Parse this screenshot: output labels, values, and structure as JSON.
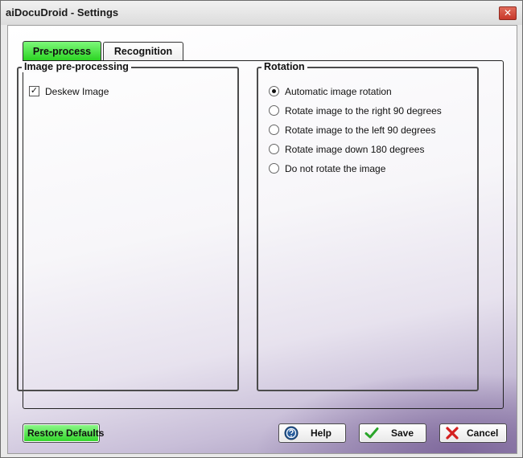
{
  "window": {
    "title": "aiDocuDroid - Settings",
    "close_symbol": "✕"
  },
  "tabs": [
    {
      "label": "Pre-process",
      "active": true
    },
    {
      "label": "Recognition",
      "active": false
    }
  ],
  "preprocessing": {
    "title": "Image pre-processing",
    "deskew": {
      "label": "Deskew Image",
      "checked": true,
      "mark": "✓"
    }
  },
  "rotation": {
    "title": "Rotation",
    "options": [
      {
        "label": "Automatic image rotation",
        "selected": true
      },
      {
        "label": "Rotate image to the right 90 degrees",
        "selected": false
      },
      {
        "label": "Rotate image to the left 90 degrees",
        "selected": false
      },
      {
        "label": "Rotate image down 180 degrees",
        "selected": false
      },
      {
        "label": "Do not rotate the image",
        "selected": false
      }
    ]
  },
  "buttons": {
    "restore_defaults": "Restore Defaults",
    "help": "Help",
    "save": "Save",
    "cancel": "Cancel"
  },
  "colors": {
    "accent_green": "#33d52b",
    "close_red": "#c8372a",
    "help_blue": "#2a5e9c"
  },
  "icons": {
    "help": "help-icon",
    "save": "checkmark-icon",
    "cancel": "x-icon",
    "close": "close-icon"
  }
}
